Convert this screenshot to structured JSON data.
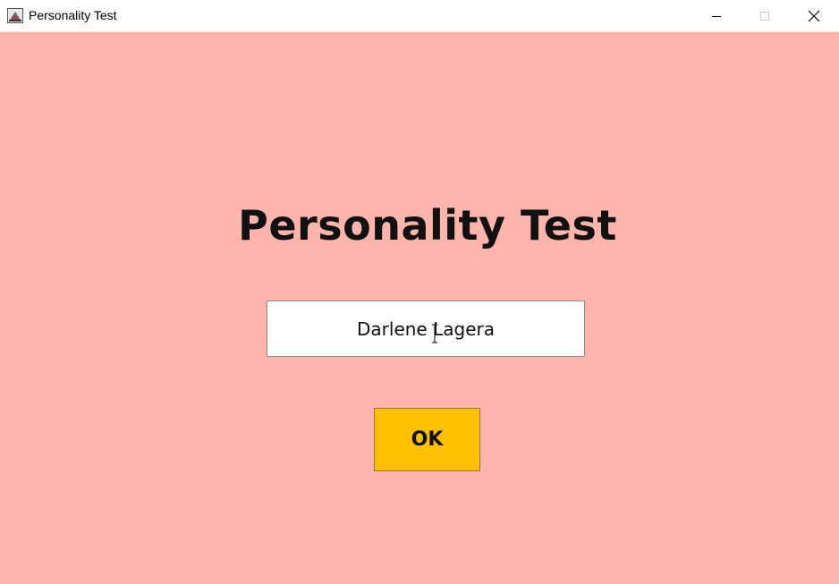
{
  "window": {
    "title": "Personality Test",
    "icon": "java-app-icon",
    "controls": {
      "minimize_icon": "minimize-icon",
      "maximize_icon": "maximize-icon",
      "close_icon": "close-icon"
    }
  },
  "content": {
    "heading": "Personality Test",
    "name_input": {
      "value": "Darlene Lagera"
    },
    "ok_label": "OK"
  },
  "colors": {
    "background": "#ffb5ac",
    "button": "#ffc000",
    "field": "#ffffff",
    "text": "#111111"
  }
}
